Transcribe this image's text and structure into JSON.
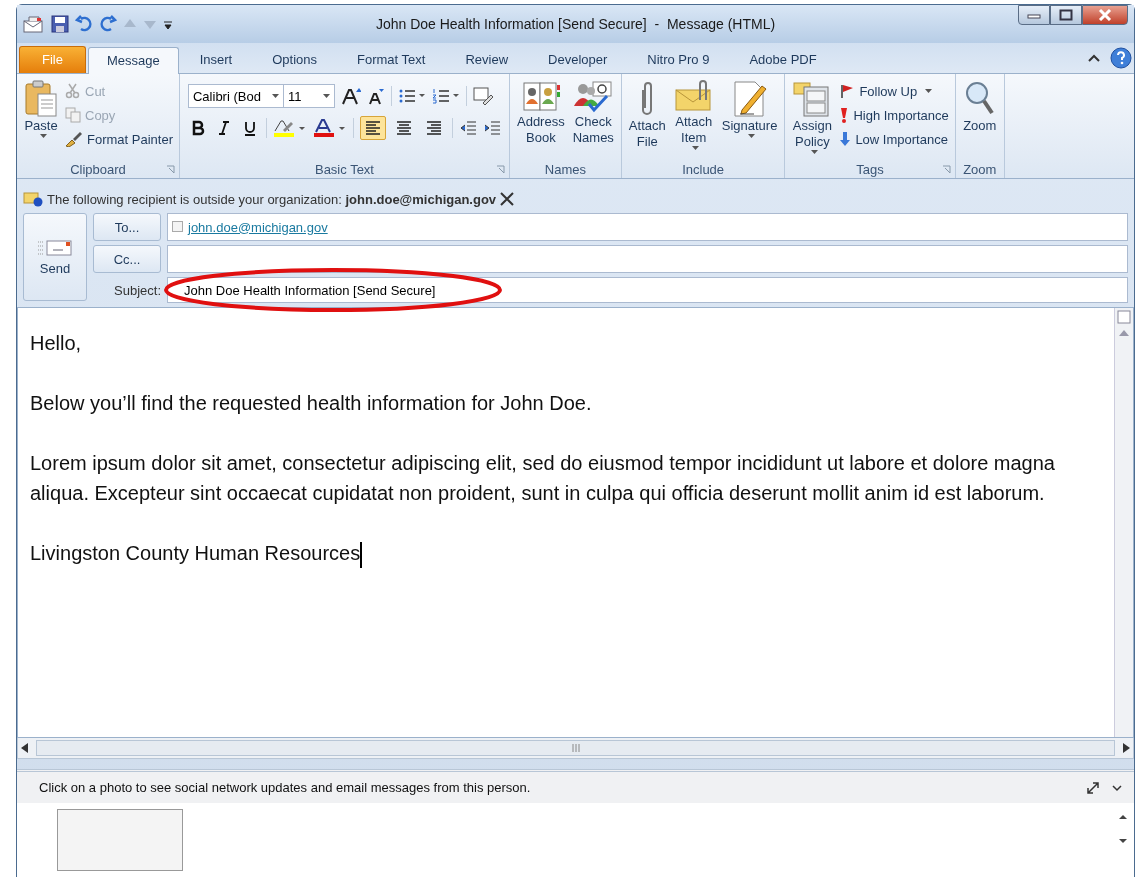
{
  "window": {
    "title": "John Doe Health Information [Send Secure]  -  Message (HTML)"
  },
  "tabs": [
    {
      "label": "File",
      "kind": "file",
      "selected": false
    },
    {
      "label": "Message",
      "kind": "tab",
      "selected": true
    },
    {
      "label": "Insert",
      "kind": "tab",
      "selected": false
    },
    {
      "label": "Options",
      "kind": "tab",
      "selected": false
    },
    {
      "label": "Format Text",
      "kind": "tab",
      "selected": false
    },
    {
      "label": "Review",
      "kind": "tab",
      "selected": false
    },
    {
      "label": "Developer",
      "kind": "tab",
      "selected": false
    },
    {
      "label": "Nitro Pro 9",
      "kind": "tab",
      "selected": false
    },
    {
      "label": "Adobe PDF",
      "kind": "tab",
      "selected": false
    }
  ],
  "ribbon": [
    {
      "label": "Clipboard",
      "kind": "clipboard",
      "launcher": true,
      "items": [
        {
          "label": "Paste",
          "kind": "large",
          "menu": true,
          "disabled": false
        },
        {
          "label": "Cut",
          "kind": "small",
          "menu": false,
          "disabled": true
        },
        {
          "label": "Copy",
          "kind": "small",
          "menu": false,
          "disabled": true
        },
        {
          "label": "Format Painter",
          "kind": "small",
          "menu": false,
          "disabled": false
        }
      ]
    },
    {
      "label": "Basic Text",
      "kind": "format",
      "launcher": true,
      "font": "Calibri (Bod",
      "size": "11",
      "align": [
        {
          "selected": true
        },
        {
          "selected": false
        },
        {
          "selected": false
        }
      ]
    },
    {
      "label": "Names",
      "kind": "buttons",
      "items": [
        {
          "label": "Address Book",
          "kind": "large",
          "menu": false,
          "disabled": false
        },
        {
          "label": "Check Names",
          "kind": "large",
          "menu": false,
          "disabled": false
        }
      ]
    },
    {
      "label": "Include",
      "kind": "buttons",
      "items": [
        {
          "label": "Attach File",
          "kind": "large",
          "menu": false,
          "disabled": false
        },
        {
          "label": "Attach Item",
          "kind": "large",
          "menu": true,
          "disabled": false
        },
        {
          "label": "Signature",
          "kind": "large",
          "menu": true,
          "disabled": false
        }
      ]
    },
    {
      "label": "Tags",
      "kind": "tags",
      "launcher": true,
      "items": [
        {
          "label": "Assign Policy",
          "kind": "large",
          "menu": true,
          "disabled": false
        },
        {
          "label": "Follow Up",
          "kind": "small",
          "menu": true,
          "disabled": false
        },
        {
          "label": "High Importance",
          "kind": "small",
          "menu": false,
          "disabled": false
        },
        {
          "label": "Low Importance",
          "kind": "small",
          "menu": false,
          "disabled": false
        }
      ]
    },
    {
      "label": "Zoom",
      "kind": "buttons",
      "items": [
        {
          "label": "Zoom",
          "kind": "large",
          "menu": false,
          "disabled": false
        }
      ]
    }
  ],
  "infobar": {
    "text": "The following recipient is outside your organization: **john.doe@michigan.gov**"
  },
  "header": {
    "send": "Send",
    "to_button": "To...",
    "to": "john.doe@michigan.gov",
    "cc_button": "Cc...",
    "subject_label": "Subject:",
    "subject": "John Doe Health Information [Send Secure]",
    "subject_circled": true
  },
  "body": {
    "paragraphs": [
      "Hello,",
      "Below you’ll find the requested health information for John Doe.",
      "Lorem ipsum dolor sit amet, consectetur adipiscing elit, sed do eiusmod tempor incididunt ut labore et dolore magna aliqua. Excepteur sint occaecat cupidatat non proident, sunt in culpa qui officia deserunt mollit anim id est laborum.",
      "Livingston County Human Resources"
    ]
  },
  "people_pane": {
    "text": "Click on a photo to see social network updates and email messages from this person."
  }
}
